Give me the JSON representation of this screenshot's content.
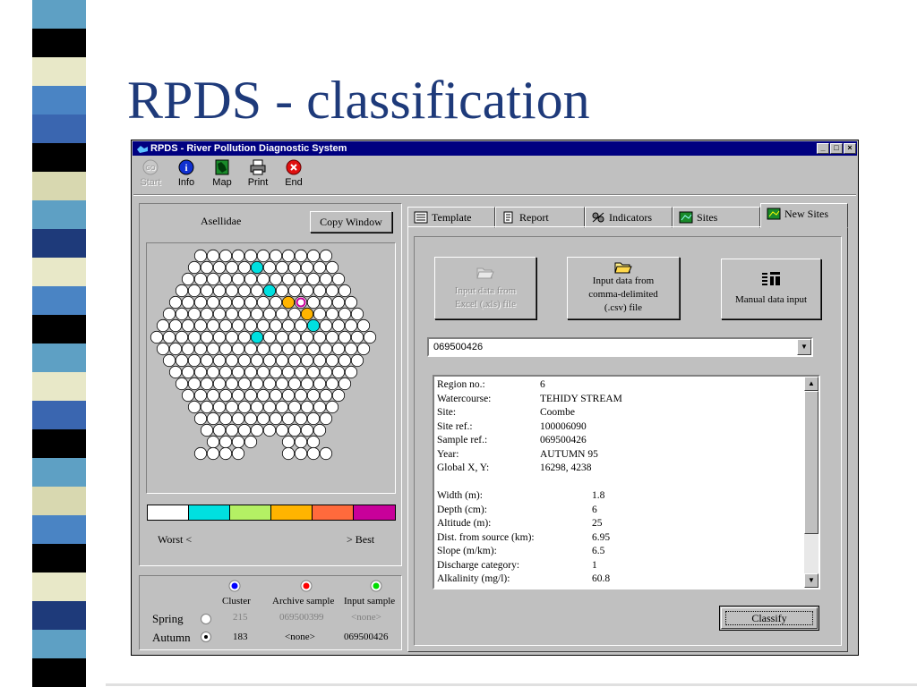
{
  "slide": {
    "title": "RPDS - classification",
    "strip_colors": [
      "#5ea0c4",
      "#000000",
      "#e8e8c8",
      "#4a84c4",
      "#3a66b0",
      "#000000",
      "#d8d8b0",
      "#5ea0c4",
      "#1e3a7a",
      "#e8e8c8",
      "#4a84c4",
      "#000000",
      "#5ea0c4",
      "#e8e8c8",
      "#3a66b0",
      "#000000",
      "#5ea0c4",
      "#d8d8b0",
      "#4a84c4",
      "#000000",
      "#e8e8c8",
      "#1e3a7a",
      "#5ea0c4",
      "#000000"
    ]
  },
  "window": {
    "title": "RPDS - River Pollution Diagnostic System",
    "controls": [
      "_",
      "□",
      "×"
    ]
  },
  "toolbar": {
    "start": "Start",
    "info": "Info",
    "map": "Map",
    "print": "Print",
    "end": "End"
  },
  "map_panel": {
    "heading": "Asellidae",
    "copy_button": "Copy Window",
    "legend_colors": [
      "#ffffff",
      "#00e0e0",
      "#b4f064",
      "#ffb400",
      "#ff6a3c",
      "#c8009a"
    ],
    "worst_label": "Worst <",
    "best_label": "> Best"
  },
  "cluster_panel": {
    "headers": {
      "cluster": "Cluster",
      "archive": "Archive sample",
      "input": "Input sample"
    },
    "header_icon_colors": [
      "#0000ff",
      "#ff0000",
      "#00dd00"
    ],
    "rows": [
      {
        "label": "Spring",
        "cluster": "215",
        "archive": "069500399",
        "input": "<none>"
      },
      {
        "label": "Autumn",
        "cluster": "183",
        "archive": "<none>",
        "input": "069500426"
      }
    ]
  },
  "tabs": [
    {
      "label": "Template",
      "icon": "template-icon"
    },
    {
      "label": "Report",
      "icon": "report-icon"
    },
    {
      "label": "Indicators",
      "icon": "indicators-icon"
    },
    {
      "label": "Sites",
      "icon": "sites-icon"
    },
    {
      "label": "New Sites",
      "icon": "new-sites-icon"
    }
  ],
  "new_sites": {
    "excel_button": [
      "Input data from",
      "Excel (.xls) file"
    ],
    "csv_button": [
      "Input data from",
      "comma-delimited",
      "(.csv) file"
    ],
    "manual_button": "Manual data input",
    "sample_select": "069500426",
    "fields": [
      {
        "label": "Region no.:",
        "value": "6"
      },
      {
        "label": "Watercourse:",
        "value": "TEHIDY STREAM"
      },
      {
        "label": "Site:",
        "value": "Coombe"
      },
      {
        "label": "Site ref.:",
        "value": "100006090"
      },
      {
        "label": "Sample ref.:",
        "value": "069500426"
      },
      {
        "label": "Year:",
        "value": "AUTUMN 95"
      },
      {
        "label": "Global X, Y:",
        "value": "16298, 4238"
      }
    ],
    "measurements": [
      {
        "label": "Width (m):",
        "value": "1.8"
      },
      {
        "label": "Depth (cm):",
        "value": "6"
      },
      {
        "label": "Altitude (m):",
        "value": "25"
      },
      {
        "label": "Dist. from source (km):",
        "value": "6.95"
      },
      {
        "label": "Slope (m/km):",
        "value": "6.5"
      },
      {
        "label": "Discharge category:",
        "value": "1"
      },
      {
        "label": "Alkalinity (mg/l):",
        "value": "60.8"
      }
    ],
    "classify_button": "Classify"
  }
}
